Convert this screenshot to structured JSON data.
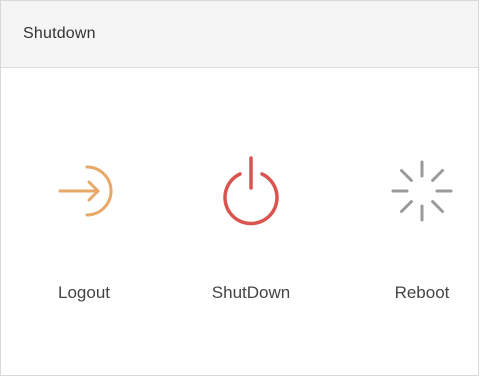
{
  "panel": {
    "title": "Shutdown"
  },
  "actions": [
    {
      "label": "Logout",
      "icon": "logout-icon",
      "color": "#e8a868"
    },
    {
      "label": "ShutDown",
      "icon": "power-icon",
      "color": "#d9534f"
    },
    {
      "label": "Reboot",
      "icon": "reboot-spinner-icon",
      "color": "#9a9a9a"
    }
  ]
}
